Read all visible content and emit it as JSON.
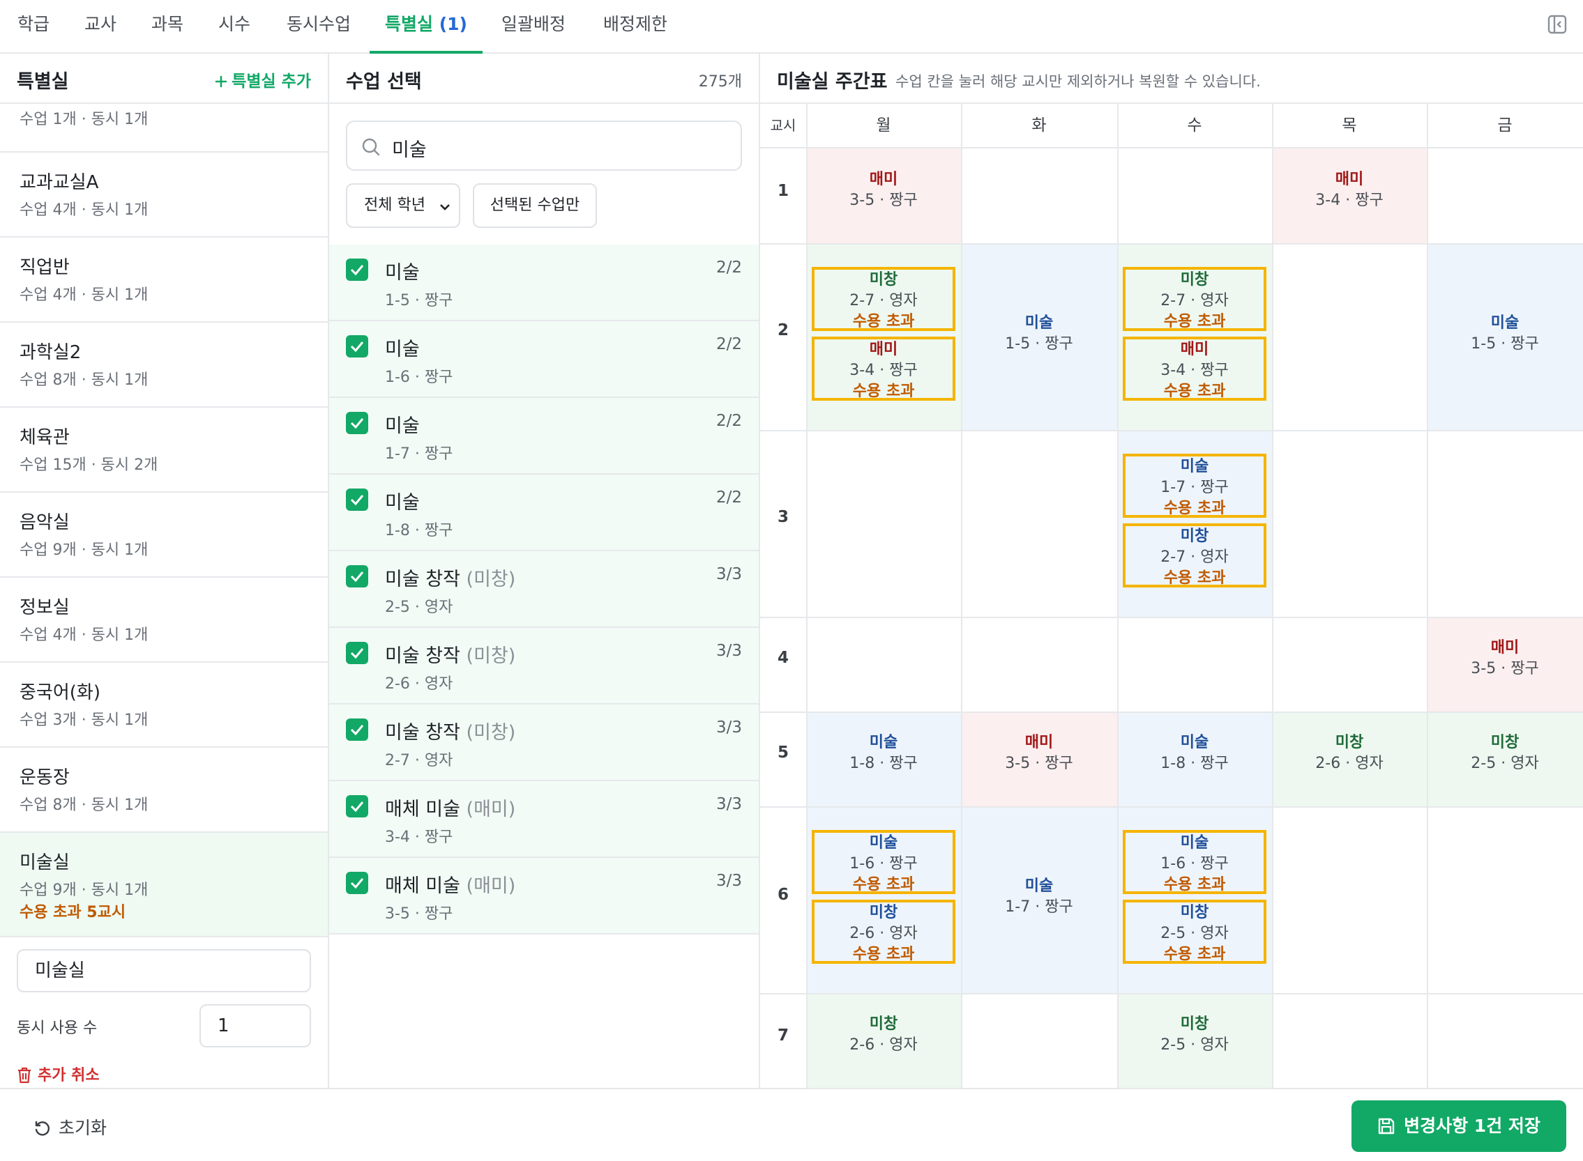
{
  "tabs": [
    {
      "label": "학급"
    },
    {
      "label": "교사"
    },
    {
      "label": "과목"
    },
    {
      "label": "시수"
    },
    {
      "label": "동시수업"
    },
    {
      "label": "특별실",
      "count": "(1)",
      "active": true
    },
    {
      "label": "일괄배정"
    },
    {
      "label": "배정제한"
    }
  ],
  "rooms_pane": {
    "title": "특별실",
    "add_label": "특별실 추가",
    "rooms": [
      {
        "name": "",
        "meta": "수업 1개 · 동시 1개"
      },
      {
        "name": "교과교실A",
        "meta": "수업 4개 · 동시 1개"
      },
      {
        "name": "직업반",
        "meta": "수업 4개 · 동시 1개"
      },
      {
        "name": "과학실2",
        "meta": "수업 8개 · 동시 1개"
      },
      {
        "name": "체육관",
        "meta": "수업 15개 · 동시 2개"
      },
      {
        "name": "음악실",
        "meta": "수업 9개 · 동시 1개"
      },
      {
        "name": "정보실",
        "meta": "수업 4개 · 동시 1개"
      },
      {
        "name": "중국어(화)",
        "meta": "수업 3개 · 동시 1개"
      },
      {
        "name": "운동장",
        "meta": "수업 8개 · 동시 1개"
      },
      {
        "name": "미술실",
        "meta": "수업 9개 · 동시 1개",
        "warn": "수용 초과 5교시",
        "selected": true
      }
    ],
    "name_value": "미술실",
    "concurrent_label": "동시 사용 수",
    "concurrent_value": "1",
    "cancel_label": "추가 취소"
  },
  "class_pane": {
    "title": "수업 선택",
    "count": "275개",
    "search_value": "미술",
    "grade_select": "전체 학년",
    "selected_only": "선택된 수업만",
    "items": [
      {
        "title": "미술",
        "abbr": "",
        "sub": "1-5 · 짱구",
        "ratio": "2/2"
      },
      {
        "title": "미술",
        "abbr": "",
        "sub": "1-6 · 짱구",
        "ratio": "2/2"
      },
      {
        "title": "미술",
        "abbr": "",
        "sub": "1-7 · 짱구",
        "ratio": "2/2"
      },
      {
        "title": "미술",
        "abbr": "",
        "sub": "1-8 · 짱구",
        "ratio": "2/2"
      },
      {
        "title": "미술 창작",
        "abbr": "(미창)",
        "sub": "2-5 · 영자",
        "ratio": "3/3"
      },
      {
        "title": "미술 창작",
        "abbr": "(미창)",
        "sub": "2-6 · 영자",
        "ratio": "3/3"
      },
      {
        "title": "미술 창작",
        "abbr": "(미창)",
        "sub": "2-7 · 영자",
        "ratio": "3/3"
      },
      {
        "title": "매체 미술",
        "abbr": "(매미)",
        "sub": "3-4 · 짱구",
        "ratio": "3/3"
      },
      {
        "title": "매체 미술",
        "abbr": "(매미)",
        "sub": "3-5 · 짱구",
        "ratio": "3/3"
      }
    ]
  },
  "timetable": {
    "title": "미술실 주간표",
    "hint": "수업 칸을 눌러 해당 교시만 제외하거나 복원할 수 있습니다.",
    "period_header": "교시",
    "days": [
      "월",
      "화",
      "수",
      "목",
      "금"
    ],
    "periods": [
      "1",
      "2",
      "3",
      "4",
      "5",
      "6",
      "7"
    ],
    "over_label": "수용 초과",
    "entries": [
      {
        "subj": "매미",
        "det": "3-5 · 짱구"
      },
      {
        "subj": "매미",
        "det": "3-4 · 짱구"
      },
      {
        "subj": "미창",
        "det": "2-7 · 영자"
      },
      {
        "subj": "매미",
        "det": "3-4 · 짱구"
      },
      {
        "subj": "미술",
        "det": "1-5 · 짱구"
      },
      {
        "subj": "미창",
        "det": "2-7 · 영자"
      },
      {
        "subj": "매미",
        "det": "3-4 · 짱구"
      },
      {
        "subj": "미술",
        "det": "1-5 · 짱구"
      },
      {
        "subj": "미술",
        "det": "1-7 · 짱구"
      },
      {
        "subj": "미창",
        "det": "2-7 · 영자"
      },
      {
        "subj": "매미",
        "det": "3-5 · 짱구"
      },
      {
        "subj": "미술",
        "det": "1-8 · 짱구"
      },
      {
        "subj": "매미",
        "det": "3-5 · 짱구"
      },
      {
        "subj": "미술",
        "det": "1-8 · 짱구"
      },
      {
        "subj": "미창",
        "det": "2-6 · 영자"
      },
      {
        "subj": "미창",
        "det": "2-5 · 영자"
      },
      {
        "subj": "미술",
        "det": "1-6 · 짱구"
      },
      {
        "subj": "미창",
        "det": "2-6 · 영자"
      },
      {
        "subj": "미술",
        "det": "1-7 · 짱구"
      },
      {
        "subj": "미술",
        "det": "1-6 · 짱구"
      },
      {
        "subj": "미창",
        "det": "2-5 · 영자"
      },
      {
        "subj": "미창",
        "det": "2-6 · 영자"
      },
      {
        "subj": "미창",
        "det": "2-5 · 영자"
      }
    ]
  },
  "footer": {
    "reset_label": "초기화",
    "save_label": "변경사항 1건 저장"
  },
  "colors": {
    "accent": "#12a866",
    "warning": "#c05a00",
    "over_border": "#f5b400",
    "art_bg": "#eef4fb",
    "media_bg": "#fcefef",
    "creative_bg": "#eef8f0"
  }
}
